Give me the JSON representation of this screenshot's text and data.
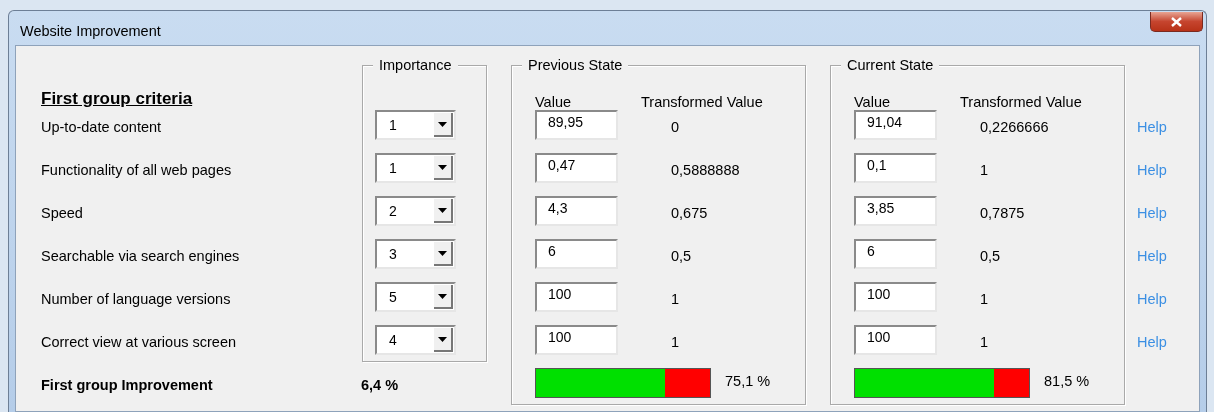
{
  "window": {
    "title": "Website Improvement"
  },
  "group_title": "First group criteria",
  "importance": {
    "legend": "Importance"
  },
  "previous_state": {
    "legend": "Previous State",
    "value_header": "Value",
    "transformed_header": "Transformed Value",
    "level": 0.74,
    "reading": "75,1 %"
  },
  "current_state": {
    "legend": "Current State",
    "value_header": "Value",
    "transformed_header": "Transformed Value",
    "level": 0.8,
    "reading": "81,5 %"
  },
  "criteria": [
    {
      "label": "Up-to-date content",
      "importance": "1",
      "previous_value": "89,95",
      "previous_transformed": "0",
      "current_value": "91,04",
      "current_transformed": "0,2266666",
      "help": "Help"
    },
    {
      "label": "Functionality of all web pages",
      "importance": "1",
      "previous_value": "0,47",
      "previous_transformed": "0,5888888",
      "current_value": "0,1",
      "current_transformed": "1",
      "help": "Help"
    },
    {
      "label": "Speed",
      "importance": "2",
      "previous_value": "4,3",
      "previous_transformed": "0,675",
      "current_value": "3,85",
      "current_transformed": "0,7875",
      "help": "Help"
    },
    {
      "label": "Searchable via search engines",
      "importance": "3",
      "previous_value": "6",
      "previous_transformed": "0,5",
      "current_value": "6",
      "current_transformed": "0,5",
      "help": "Help"
    },
    {
      "label": "Number of language versions",
      "importance": "5",
      "previous_value": "100",
      "previous_transformed": "1",
      "current_value": "100",
      "current_transformed": "1",
      "help": "Help"
    },
    {
      "label": "Correct view at various screen",
      "importance": "4",
      "previous_value": "100",
      "previous_transformed": "1",
      "current_value": "100",
      "current_transformed": "1",
      "help": "Help"
    }
  ],
  "summary": {
    "label": "First group Improvement",
    "value": "6,4 %"
  }
}
